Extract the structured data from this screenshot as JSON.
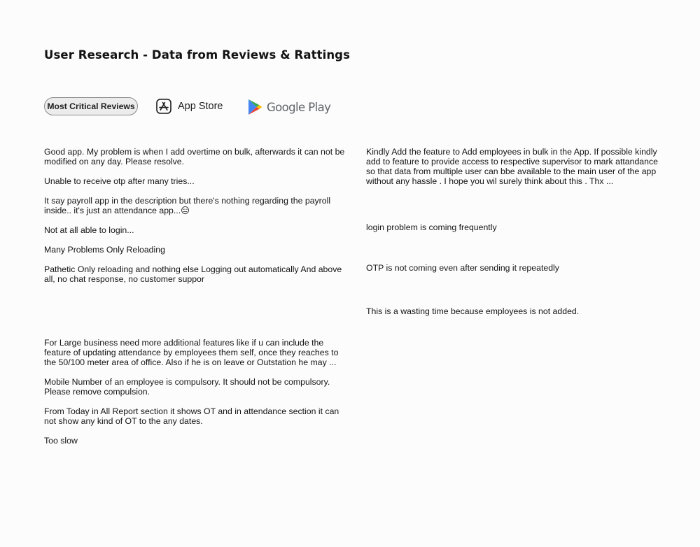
{
  "title": "User Research - Data from Reviews & Rattings",
  "filters": {
    "critical_label": "Most Critical Reviews",
    "appstore_label": "App Store",
    "googleplay_label": "Google Play"
  },
  "reviews_left": [
    "Good app. My problem is when I add overtime on bulk, afterwards it can not be modified on any day. Please resolve.",
    "Unable to receive otp after many tries...",
    "It say payroll app in the description but there's nothing regarding the payroll inside.. it's just an attendance app...😑",
    "Not at all able to login...",
    "Many Problems Only Reloading",
    "Pathetic Only reloading and nothing else Logging out automatically And above all, no chat response, no customer suppor",
    "For Large business need more additional features like if u can include the feature of updating attendance by employees them self, once they reaches to the 50/100 meter area of office. Also if he is on leave or Outstation he may ...",
    "Mobile Number of an employee is compulsory. It should not be compulsory. Please remove compulsion.",
    "From Today in All Report section it shows OT and in attendance section it can not show any kind of OT to the any dates.",
    "Too slow"
  ],
  "reviews_right": [
    "Kindly Add the feature to Add employees in bulk in the App. If possible kindly add to feature to provide access to respective supervisor to mark attandance so that data from multiple user can bbe available to the main user of the app without any hassle . I hope you wil surely think about this . Thx ...",
    "login problem is coming frequently",
    "OTP is not coming even after sending it repeatedly",
    "This is a wasting time because employees is not added."
  ],
  "icons": {
    "appstore": "app-store-icon",
    "googleplay": "google-play-icon"
  },
  "colors": {
    "google_blue": "#4285f4",
    "google_green": "#34a853",
    "google_yellow": "#fbbc04",
    "google_red": "#ea4335"
  }
}
